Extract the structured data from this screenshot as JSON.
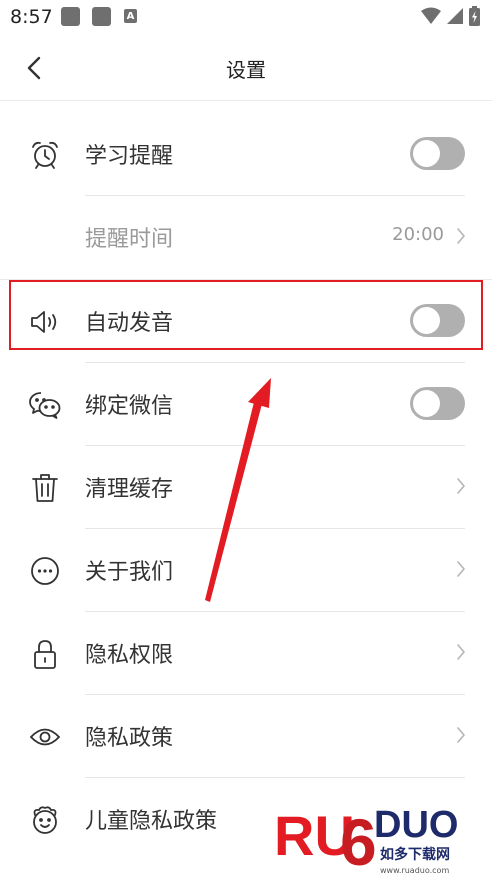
{
  "status": {
    "time": "8:57",
    "notif_letter": "A"
  },
  "header": {
    "title": "设置"
  },
  "rows": [
    {
      "label": "学习提醒",
      "icon": "alarm-clock-icon",
      "control": "toggle",
      "on": false
    },
    {
      "label": "提醒时间",
      "value": "20:00",
      "control": "chevron"
    },
    {
      "label": "自动发音",
      "icon": "speaker-icon",
      "control": "toggle",
      "on": false
    },
    {
      "label": "绑定微信",
      "icon": "wechat-icon",
      "control": "toggle",
      "on": false
    },
    {
      "label": "清理缓存",
      "icon": "trash-icon",
      "control": "chevron"
    },
    {
      "label": "关于我们",
      "icon": "more-dots-icon",
      "control": "chevron"
    },
    {
      "label": "隐私权限",
      "icon": "lock-icon",
      "control": "chevron"
    },
    {
      "label": "隐私政策",
      "icon": "eye-icon",
      "control": "chevron"
    },
    {
      "label": "儿童隐私政策",
      "icon": "child-face-icon",
      "control": "none"
    }
  ],
  "watermark": {
    "brand": "RUAODUO",
    "site_cn": "如多下载网",
    "url": "www.ruaduo.com"
  },
  "colors": {
    "accent": "#e31b23",
    "toggle_off": "#b0b0b0",
    "text": "#333333",
    "muted": "#9a9a9a"
  }
}
